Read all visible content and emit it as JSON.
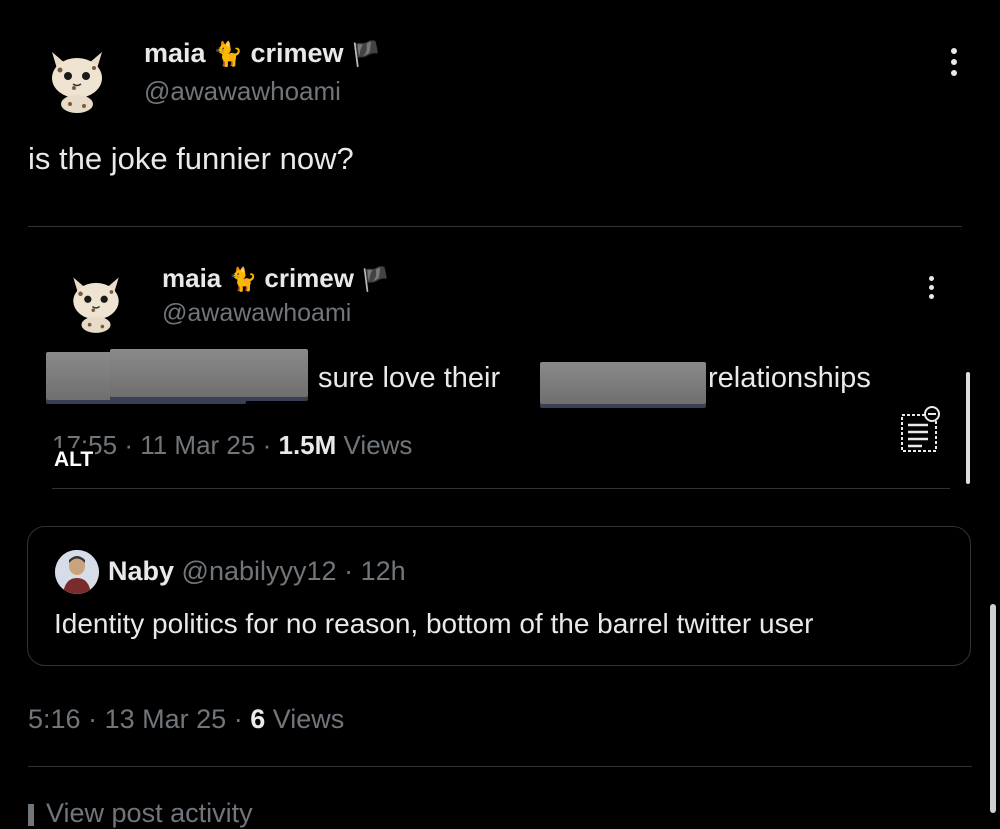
{
  "post": {
    "author": {
      "name_first": "maia",
      "name_emoji": "🐈",
      "name_last": "crimew",
      "flag": "🏴",
      "handle": "@awawawhoami"
    },
    "text": "is the joke funnier now?",
    "quoted": {
      "author": {
        "name_first": "maia",
        "name_emoji": "🐈",
        "name_last": "crimew",
        "flag": "🏴",
        "handle": "@awawawhoami"
      },
      "text_middle": "sure love their",
      "text_end": "relationships",
      "time": "17:55",
      "date": "11 Mar 25",
      "views_count": "1.5M",
      "views_label": "Views",
      "alt_badge": "ALT"
    },
    "reply": {
      "name": "Naby",
      "handle": "@nabilyyy12",
      "age": "12h",
      "text": "Identity politics for no reason, bottom of the barrel twitter user"
    },
    "time": "5:16",
    "date": "13 Mar 25",
    "views_count": "6",
    "views_label": "Views",
    "activity_link": "View post activity"
  },
  "separator": "·"
}
